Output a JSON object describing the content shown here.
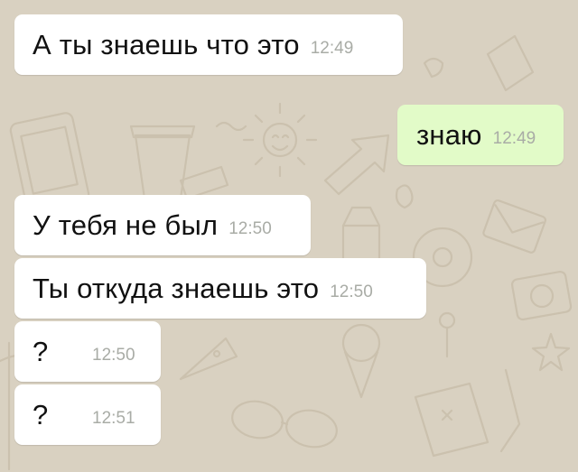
{
  "chat": {
    "messages": [
      {
        "direction": "incoming",
        "text": "А ты знаешь что это",
        "time": "12:49"
      },
      {
        "direction": "outgoing",
        "text": "знаю",
        "time": "12:49"
      },
      {
        "direction": "incoming",
        "text": "У тебя не был",
        "time": "12:50"
      },
      {
        "direction": "incoming",
        "text": "Ты откуда знаешь это",
        "time": "12:50"
      },
      {
        "direction": "incoming",
        "text": "?",
        "time": "12:50"
      },
      {
        "direction": "incoming",
        "text": "?",
        "time": "12:51"
      }
    ]
  },
  "colors": {
    "wallpaper": "#d9d1c1",
    "doodle": "#cbc1ae",
    "incoming_bubble": "#ffffff",
    "outgoing_bubble": "#e2fbc8",
    "timestamp": "#a9aca6"
  }
}
